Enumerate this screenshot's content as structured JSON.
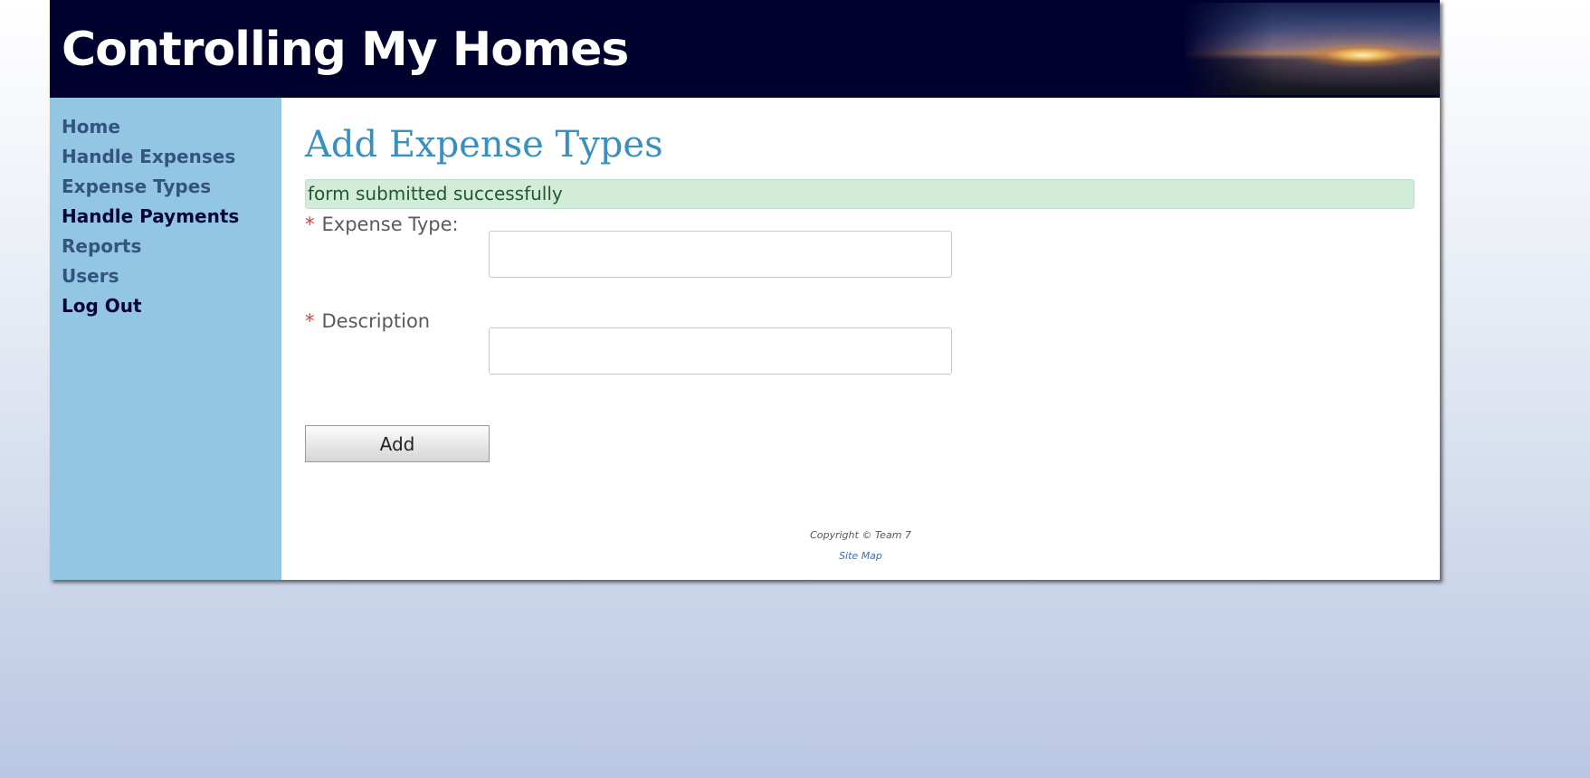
{
  "header": {
    "title": "Controlling My Homes"
  },
  "sidebar": {
    "items": [
      {
        "label": "Home"
      },
      {
        "label": "Handle Expenses"
      },
      {
        "label": "Expense Types"
      },
      {
        "label": "Handle Payments"
      },
      {
        "label": "Reports"
      },
      {
        "label": "Users"
      },
      {
        "label": "Log Out"
      }
    ]
  },
  "main": {
    "title": "Add Expense Types",
    "success_message": "form submitted successfully",
    "fields": [
      {
        "required_mark": "*",
        "label": "Expense Type:",
        "value": ""
      },
      {
        "required_mark": "*",
        "label": "Description",
        "value": ""
      }
    ],
    "submit_label": "Add"
  },
  "footer": {
    "copyright": "Copyright © Team 7",
    "sitemap_label": "Site Map"
  },
  "colors": {
    "header_bg": "#01012d",
    "sidebar_bg": "#93c6e2",
    "title_color": "#3a8fc1",
    "success_bg": "#d3ecd9"
  }
}
